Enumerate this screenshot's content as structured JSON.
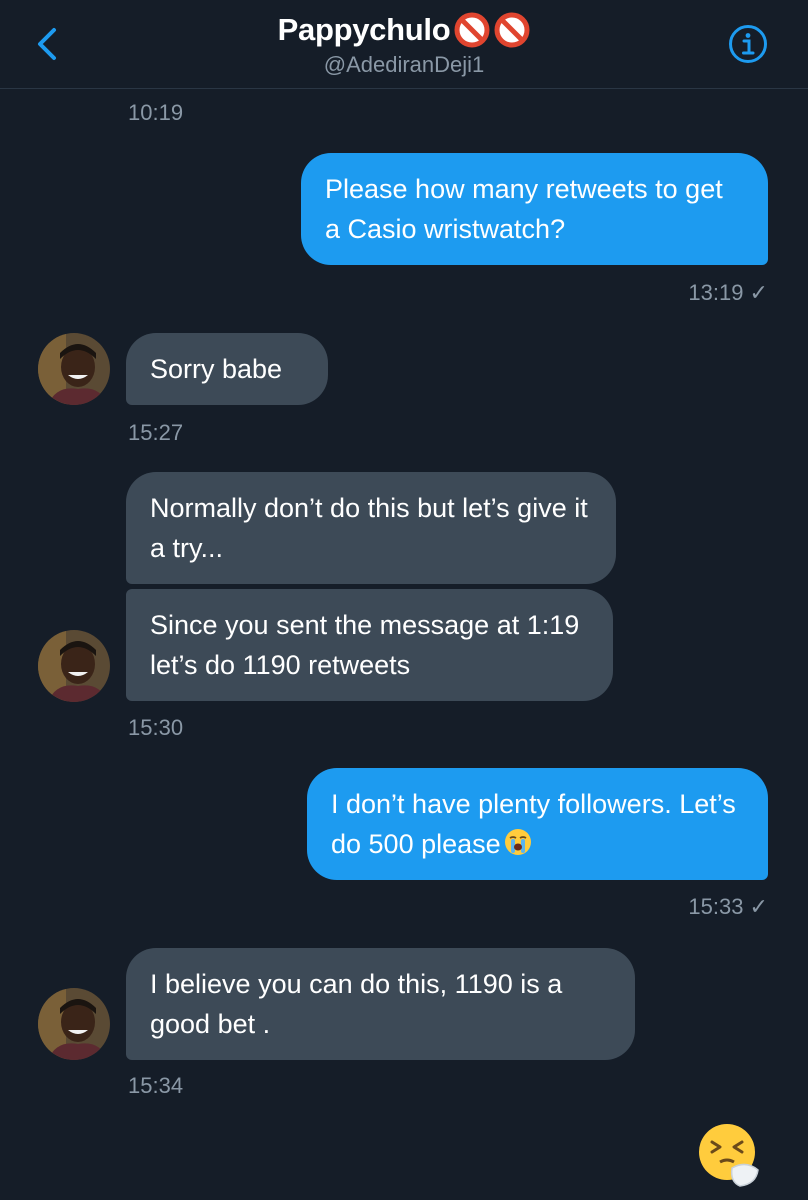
{
  "header": {
    "name": "Pappychulo",
    "name_emojis": [
      "no-entry-emoji",
      "no-entry-emoji"
    ],
    "handle": "@AdediranDeji1",
    "accent_color": "#1d9bf0"
  },
  "messages": [
    {
      "type": "timestamp",
      "text": "10:19"
    },
    {
      "type": "outgoing",
      "text": "Please how many retweets to get a Casio wristwatch?"
    },
    {
      "type": "timestamp",
      "text": "13:19 ✓"
    },
    {
      "type": "incoming",
      "text": "Sorry babe"
    },
    {
      "type": "timestamp",
      "text": "15:27"
    },
    {
      "type": "incoming",
      "text": "Normally don’t do this but let’s give it a try..."
    },
    {
      "type": "incoming",
      "text": "Since you sent the message at 1:19 let’s do 1190 retweets"
    },
    {
      "type": "timestamp",
      "text": "15:30"
    },
    {
      "type": "outgoing",
      "text": "I don’t have plenty followers. Let’s do 500 please",
      "emoji": "loudly-crying-face-emoji"
    },
    {
      "type": "timestamp",
      "text": "15:33 ✓"
    },
    {
      "type": "incoming",
      "text": "I believe you can do this, 1190 is a good bet ."
    },
    {
      "type": "timestamp",
      "text": "15:34"
    },
    {
      "type": "emoji",
      "text": "sneezing-face-emoji"
    }
  ]
}
